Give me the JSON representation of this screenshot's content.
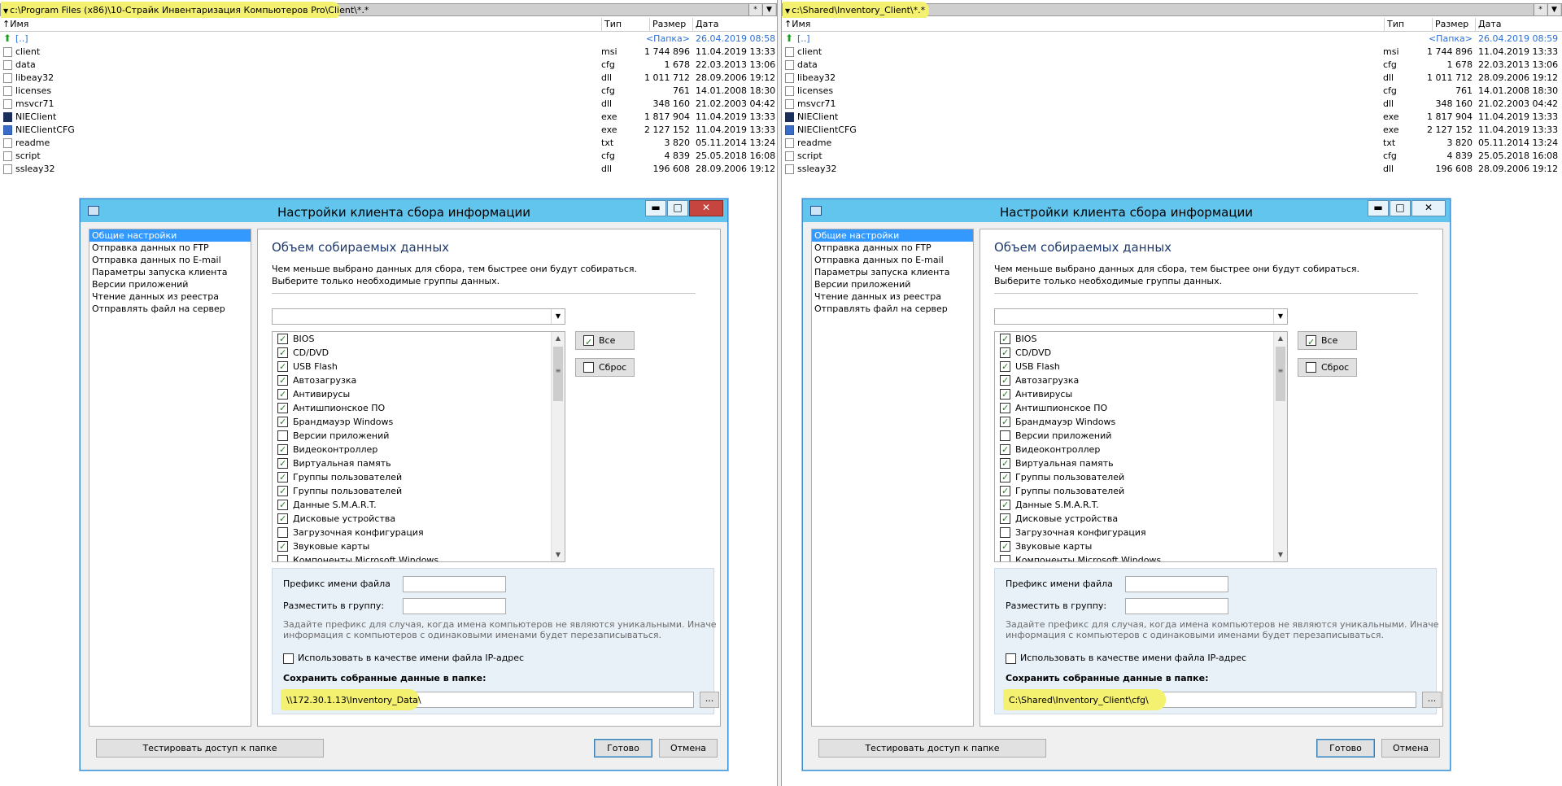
{
  "columns": {
    "name": "Имя",
    "ext": "Тип",
    "size": "Размер",
    "date": "Дата"
  },
  "left_panel": {
    "path": "c:\\Program Files (x86)\\10-Страйк Инвентаризация Компьютеров Pro\\Client\\*.*",
    "star": "*",
    "menu": "▼",
    "files": [
      {
        "name": "[..]",
        "ext": "",
        "size": "<Папка>",
        "date": "26.04.2019 08:58",
        "icon": "up-arrow-icon"
      },
      {
        "name": "client",
        "ext": "msi",
        "size": "1 744 896",
        "date": "11.04.2019 13:33",
        "icon": "msi-file-icon"
      },
      {
        "name": "data",
        "ext": "cfg",
        "size": "1 678",
        "date": "22.03.2013 13:06",
        "icon": "file-icon"
      },
      {
        "name": "libeay32",
        "ext": "dll",
        "size": "1 011 712",
        "date": "28.09.2006 19:12",
        "icon": "dll-file-icon"
      },
      {
        "name": "licenses",
        "ext": "cfg",
        "size": "761",
        "date": "14.01.2008 18:30",
        "icon": "file-icon"
      },
      {
        "name": "msvcr71",
        "ext": "dll",
        "size": "348 160",
        "date": "21.02.2003 04:42",
        "icon": "dll-file-icon"
      },
      {
        "name": "NIEClient",
        "ext": "exe",
        "size": "1 817 904",
        "date": "11.04.2019 13:33",
        "icon": "exe-file-icon"
      },
      {
        "name": "NIEClientCFG",
        "ext": "exe",
        "size": "2 127 152",
        "date": "11.04.2019 13:33",
        "icon": "cfg-exe-file-icon"
      },
      {
        "name": "readme",
        "ext": "txt",
        "size": "3 820",
        "date": "05.11.2014 13:24",
        "icon": "file-icon"
      },
      {
        "name": "script",
        "ext": "cfg",
        "size": "4 839",
        "date": "25.05.2018 16:08",
        "icon": "file-icon"
      },
      {
        "name": "ssleay32",
        "ext": "dll",
        "size": "196 608",
        "date": "28.09.2006 19:12",
        "icon": "dll-file-icon"
      }
    ]
  },
  "right_panel": {
    "path": "c:\\Shared\\Inventory_Client\\*.*",
    "star": "*",
    "menu": "▼",
    "files": [
      {
        "name": "[..]",
        "ext": "",
        "size": "<Папка>",
        "date": "26.04.2019 08:59",
        "icon": "up-arrow-icon"
      },
      {
        "name": "client",
        "ext": "msi",
        "size": "1 744 896",
        "date": "11.04.2019 13:33",
        "icon": "msi-file-icon"
      },
      {
        "name": "data",
        "ext": "cfg",
        "size": "1 678",
        "date": "22.03.2013 13:06",
        "icon": "file-icon"
      },
      {
        "name": "libeay32",
        "ext": "dll",
        "size": "1 011 712",
        "date": "28.09.2006 19:12",
        "icon": "dll-file-icon"
      },
      {
        "name": "licenses",
        "ext": "cfg",
        "size": "761",
        "date": "14.01.2008 18:30",
        "icon": "file-icon"
      },
      {
        "name": "msvcr71",
        "ext": "dll",
        "size": "348 160",
        "date": "21.02.2003 04:42",
        "icon": "dll-file-icon"
      },
      {
        "name": "NIEClient",
        "ext": "exe",
        "size": "1 817 904",
        "date": "11.04.2019 13:33",
        "icon": "exe-file-icon"
      },
      {
        "name": "NIEClientCFG",
        "ext": "exe",
        "size": "2 127 152",
        "date": "11.04.2019 13:33",
        "icon": "cfg-exe-file-icon"
      },
      {
        "name": "readme",
        "ext": "txt",
        "size": "3 820",
        "date": "05.11.2014 13:24",
        "icon": "file-icon"
      },
      {
        "name": "script",
        "ext": "cfg",
        "size": "4 839",
        "date": "25.05.2018 16:08",
        "icon": "file-icon"
      },
      {
        "name": "ssleay32",
        "ext": "dll",
        "size": "196 608",
        "date": "28.09.2006 19:12",
        "icon": "dll-file-icon"
      }
    ]
  },
  "dialog": {
    "title": "Настройки клиента сбора информации",
    "minimize": "▬",
    "maximize": "□",
    "close": "✕",
    "nav": [
      "Общие настройки",
      "Отправка данных по FTP",
      "Отправка данных по E-mail",
      "Параметры запуска клиента",
      "Версии приложений",
      "Чтение данных из реестра",
      "Отправлять файл на сервер"
    ],
    "heading": "Объем собираемых данных",
    "desc1": "Чем меньше выбрано данных для сбора, тем быстрее они будут собираться.",
    "desc2": "Выберите только необходимые группы данных.",
    "combo_value": "",
    "checklist": [
      {
        "label": "BIOS",
        "checked": true
      },
      {
        "label": "CD/DVD",
        "checked": true
      },
      {
        "label": "USB Flash",
        "checked": true
      },
      {
        "label": "Автозагрузка",
        "checked": true
      },
      {
        "label": "Антивирусы",
        "checked": true
      },
      {
        "label": "Антишпионское ПО",
        "checked": true
      },
      {
        "label": "Брандмауэр Windows",
        "checked": true
      },
      {
        "label": "Версии приложений",
        "checked": false
      },
      {
        "label": "Видеоконтроллер",
        "checked": true
      },
      {
        "label": "Виртуальная память",
        "checked": true
      },
      {
        "label": "Группы пользователей",
        "checked": true
      },
      {
        "label": "Группы пользователей",
        "checked": true
      },
      {
        "label": "Данные S.M.A.R.T.",
        "checked": true
      },
      {
        "label": "Дисковые устройства",
        "checked": true
      },
      {
        "label": "Загрузочная конфигурация",
        "checked": false
      },
      {
        "label": "Звуковые карты",
        "checked": true
      },
      {
        "label": "Компоненты Microsoft Windows",
        "checked": false
      }
    ],
    "select_all": "Все",
    "reset": "Сброс",
    "prefix_label": "Префикс имени файла",
    "group_label": "Разместить в группу:",
    "hint1": "Задайте префикс для случая, когда имена компьютеров не являются уникальными. Иначе",
    "hint2": "информация с компьютеров с одинаковыми именами будет перезаписываться.",
    "ip_label": "Использовать в качестве имени файла IP-адрес",
    "save_label": "Сохранить собранные данные в папке:",
    "browse": "...",
    "test_button": "Тестировать доступ к папке",
    "ok_button": "Готово",
    "cancel_button": "Отмена"
  },
  "left_dialog": {
    "save_path": "\\\\172.30.1.13\\Inventory_Data\\"
  },
  "right_dialog": {
    "save_path": "C:\\Shared\\Inventory_Client\\cfg\\"
  }
}
